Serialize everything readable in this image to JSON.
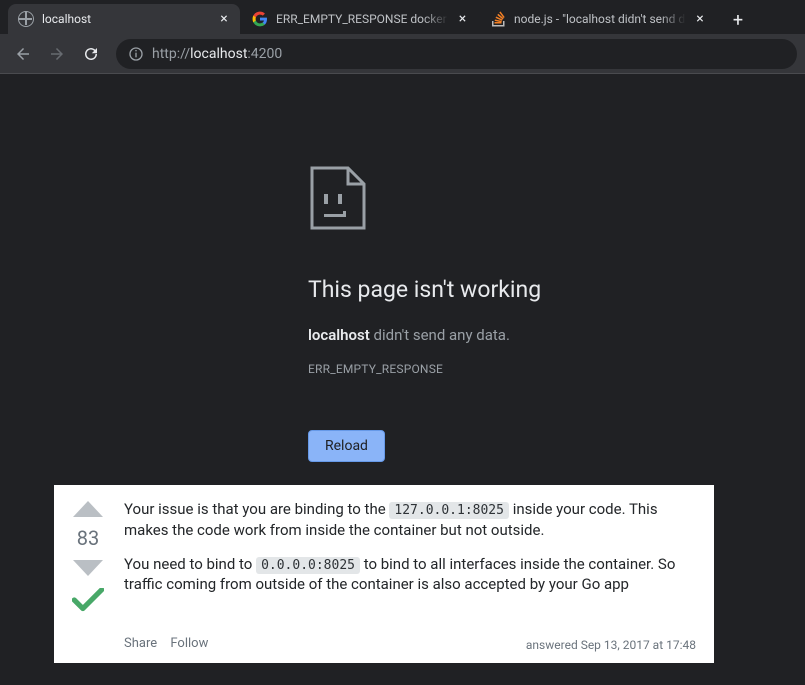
{
  "tabs": [
    {
      "title": "localhost",
      "active": true
    },
    {
      "title": "ERR_EMPTY_RESPONSE docker \"a",
      "active": false,
      "favicon": "google"
    },
    {
      "title": "node.js - \"localhost didn't send d",
      "active": false,
      "favicon": "stackoverflow"
    }
  ],
  "url": {
    "scheme": "http://",
    "host": "localhost",
    "port": ":4200"
  },
  "error": {
    "title": "This page isn't working",
    "host": "localhost",
    "subtext": " didn't send any data.",
    "code": "ERR_EMPTY_RESPONSE",
    "reload": "Reload"
  },
  "answer": {
    "score": "83",
    "p1_a": "Your issue is that you are binding to the ",
    "p1_code": "127.0.0.1:8025",
    "p1_b": " inside your code. This makes the code work from inside the container but not outside.",
    "p2_a": "You need to bind to ",
    "p2_code": "0.0.0.0:8025",
    "p2_b": " to bind to all interfaces inside the container. So traffic coming from outside of the container is also accepted by your Go app",
    "share": "Share",
    "follow": "Follow",
    "answered": "answered Sep 13, 2017 at 17:48"
  }
}
